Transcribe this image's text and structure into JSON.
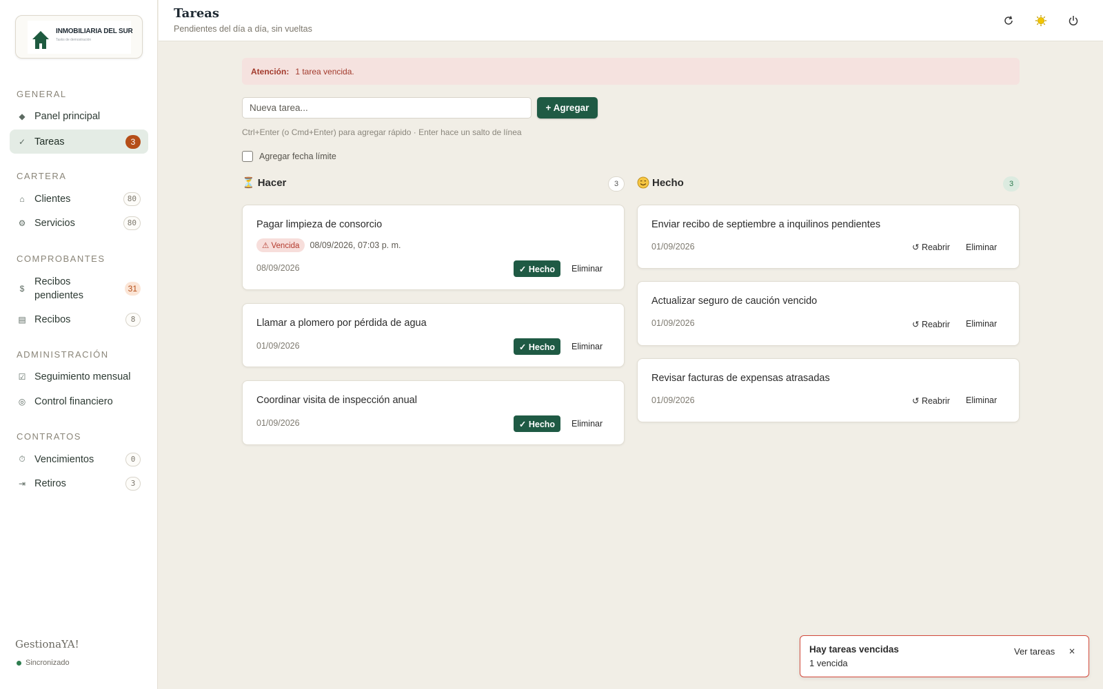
{
  "sidebar": {
    "logo": {
      "title": "INMOBILIARIA DEL SUR",
      "subtitle": "Tasks de demostración"
    },
    "sections": [
      {
        "label": "GENERAL"
      },
      {
        "label": "CARTERA"
      },
      {
        "label": "COMPROBANTES"
      },
      {
        "label": "ADMINISTRACIÓN"
      },
      {
        "label": "CONTRATOS"
      }
    ],
    "items": [
      {
        "label": "Panel principal",
        "icon": "◆",
        "icon_name": "diamond-icon"
      },
      {
        "label": "Tareas",
        "icon": "✓",
        "icon_name": "check-icon",
        "badge": "3",
        "active": true
      },
      {
        "label": "Clientes",
        "icon": "⌂",
        "icon_name": "home-icon",
        "badge": "80"
      },
      {
        "label": "Servicios",
        "icon": "⚙",
        "icon_name": "gear-icon",
        "badge": "80"
      },
      {
        "label": "Recibos",
        "label2": "pendientes",
        "icon": "$",
        "icon_name": "dollar-icon",
        "badge": "31"
      },
      {
        "label": "Recibos",
        "icon": "▤",
        "icon_name": "receipt-icon",
        "badge": "8"
      },
      {
        "label": "Seguimiento mensual",
        "icon": "☑",
        "icon_name": "checkbox-icon"
      },
      {
        "label": "Control financiero",
        "icon": "◎",
        "icon_name": "finance-icon"
      },
      {
        "label": "Vencimientos",
        "icon": "⏱",
        "icon_name": "timer-icon",
        "badge": "0"
      },
      {
        "label": "Retiros",
        "icon": "⇥",
        "icon_name": "exit-icon",
        "badge": "3"
      }
    ],
    "brand": "GestionaYA!",
    "sync_status": "Sincronizado"
  },
  "header": {
    "title": "Tareas",
    "subtitle": "Pendientes del día a día, sin vueltas",
    "icons": [
      "refresh-icon",
      "sun-icon",
      "power-icon"
    ]
  },
  "alert": {
    "label": "Atención:",
    "text": "1 tarea vencida."
  },
  "form": {
    "placeholder": "Nueva tarea...",
    "add_label": "+ Agregar",
    "hint": "Ctrl+Enter (o Cmd+Enter) para agregar rápido · Enter hace un salto de línea",
    "deadline_label": "Agregar fecha límite"
  },
  "columns": {
    "todo": {
      "emoji": "⏳",
      "title": "Hacer",
      "count": "3",
      "cards": [
        {
          "title": "Pagar limpieza de consorcio",
          "overdue_label": "⚠ Vencida",
          "due": "08/09/2026, 07:03 p. m.",
          "date": "08/09/2026",
          "done_label": "✓ Hecho",
          "delete_label": "Eliminar"
        },
        {
          "title": "Llamar a plomero por pérdida de agua",
          "date": "01/09/2026",
          "done_label": "✓ Hecho",
          "delete_label": "Eliminar"
        },
        {
          "title": "Coordinar visita de inspección anual",
          "date": "01/09/2026",
          "done_label": "✓ Hecho",
          "delete_label": "Eliminar"
        }
      ]
    },
    "done": {
      "emoji": "😊",
      "title": "Hecho",
      "count": "3",
      "cards": [
        {
          "title": "Enviar recibo de septiembre a inquilinos pendientes",
          "date": "01/09/2026",
          "reopen_label": "↺ Reabrir",
          "delete_label": "Eliminar"
        },
        {
          "title": "Actualizar seguro de caución vencido",
          "date": "01/09/2026",
          "reopen_label": "↺ Reabrir",
          "delete_label": "Eliminar"
        },
        {
          "title": "Revisar facturas de expensas atrasadas",
          "date": "01/09/2026",
          "reopen_label": "↺ Reabrir",
          "delete_label": "Eliminar"
        }
      ]
    }
  },
  "toast": {
    "title": "Hay tareas vencidas",
    "subtitle": "1 vencida",
    "action_label": "Ver tareas",
    "close_label": "×"
  },
  "colors": {
    "primary": "#1f5a44",
    "background": "#f1eee6",
    "alert_bg": "#f5e2df",
    "alert_text": "#a23a2c",
    "badge_orange": "#b54e18"
  }
}
